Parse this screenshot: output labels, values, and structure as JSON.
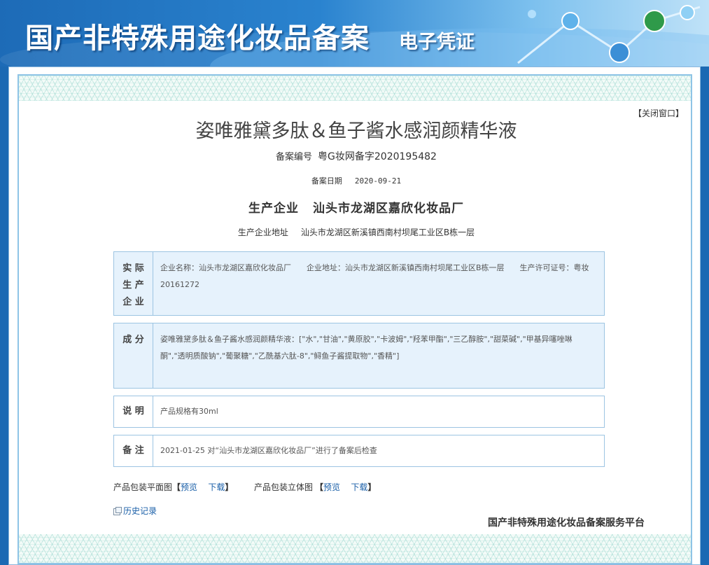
{
  "header": {
    "title": "国产非特殊用途化妆品备案",
    "subtitle": "电子凭证"
  },
  "close_link": "【关闭窗口】",
  "product": {
    "name": "姿唯雅黛多肽＆鱼子酱水感润颜精华液",
    "reg_label": "备案编号",
    "reg_value": "粤G妆网备字2020195482",
    "date_label": "备案日期",
    "date_value": "2020-09-21",
    "maker_label": "生产企业",
    "maker_value": "汕头市龙湖区嘉欣化妆品厂",
    "addr_label": "生产企业地址",
    "addr_value": "汕头市龙湖区新溪镇西南村坝尾工业区B栋一层"
  },
  "sections": {
    "actual_maker": {
      "label": [
        "实 际",
        "生 产",
        "企 业"
      ],
      "company_name": "企业名称：汕头市龙湖区嘉欣化妆品厂",
      "company_addr": "企业地址：汕头市龙湖区新溪镇西南村坝尾工业区B栋一层",
      "license": "生产许可证号：粤妆20161272"
    },
    "ingredients": {
      "label": "成 分",
      "text": "姿唯雅黛多肽＆鱼子酱水感润颜精华液：[\"水\",\"甘油\",\"黄原胶\",\"卡波姆\",\"羟苯甲酯\",\"三乙醇胺\",\"甜菜碱\",\"甲基异噻唑啉酮\",\"透明质酸钠\",\"葡聚糖\",\"乙酰基六肽-8\",\"鲟鱼子酱提取物\",\"香精\"]"
    },
    "description": {
      "label": "说 明",
      "text": "产品规格有30ml"
    },
    "remarks": {
      "label": "备 注",
      "text": "2021-01-25 对“汕头市龙湖区嘉欣化妆品厂”进行了备案后检查"
    }
  },
  "packaging": {
    "flat_label": "产品包装平面图",
    "solid_label": "产品包装立体图",
    "preview": "预览",
    "download": "下载",
    "open": "【",
    "close": "】"
  },
  "history_link": "历史记录",
  "platform_name": "国产非特殊用途化妆品备案服务平台"
}
